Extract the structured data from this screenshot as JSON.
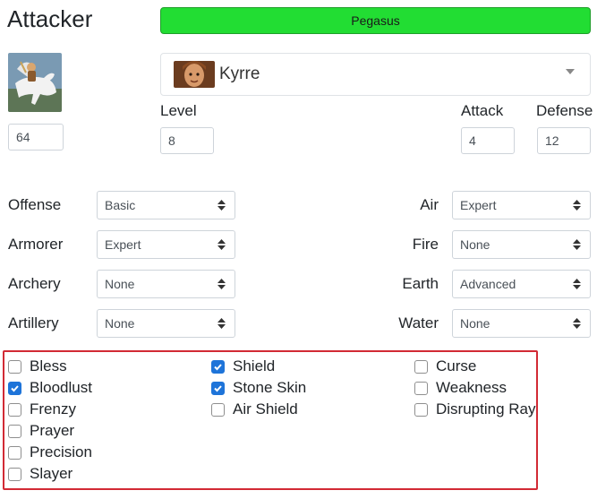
{
  "title": "Attacker",
  "unit": {
    "name": "Pegasus",
    "color": "#22dd33"
  },
  "portrait": {
    "icon": "pegasus-rider-portrait",
    "value": "64"
  },
  "hero": {
    "name": "Kyrre",
    "icon": "hero-portrait"
  },
  "fields": {
    "level": {
      "label": "Level",
      "value": "8"
    },
    "attack": {
      "label": "Attack",
      "value": "4"
    },
    "defense": {
      "label": "Defense",
      "value": "12"
    }
  },
  "skills_left": [
    {
      "label": "Offense",
      "value": "Basic"
    },
    {
      "label": "Armorer",
      "value": "Expert"
    },
    {
      "label": "Archery",
      "value": "None"
    },
    {
      "label": "Artillery",
      "value": "None"
    }
  ],
  "skills_right": [
    {
      "label": "Air",
      "value": "Expert"
    },
    {
      "label": "Fire",
      "value": "None"
    },
    {
      "label": "Earth",
      "value": "Advanced"
    },
    {
      "label": "Water",
      "value": "None"
    }
  ],
  "spells": {
    "col1": [
      {
        "label": "Bless",
        "checked": false
      },
      {
        "label": "Bloodlust",
        "checked": true
      },
      {
        "label": "Frenzy",
        "checked": false
      },
      {
        "label": "Prayer",
        "checked": false
      },
      {
        "label": "Precision",
        "checked": false
      },
      {
        "label": "Slayer",
        "checked": false
      }
    ],
    "col2": [
      {
        "label": "Shield",
        "checked": true
      },
      {
        "label": "Stone Skin",
        "checked": true
      },
      {
        "label": "Air Shield",
        "checked": false
      }
    ],
    "col3": [
      {
        "label": "Curse",
        "checked": false
      },
      {
        "label": "Weakness",
        "checked": false
      },
      {
        "label": "Disrupting Ray",
        "checked": false
      }
    ]
  },
  "highlight_color": "#d22a35",
  "check_color": "#1e74d9"
}
